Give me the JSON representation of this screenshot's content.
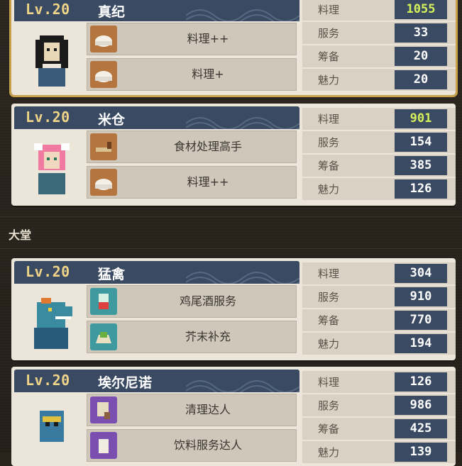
{
  "section": {
    "title": "大堂"
  },
  "cards": [
    {
      "level": "Lv.20",
      "name": "真纪",
      "skills": [
        {
          "label": "料理++",
          "icon": "rice-icon"
        },
        {
          "label": "料理+",
          "icon": "rice-icon"
        }
      ],
      "stats": [
        {
          "k": "料理",
          "v": "1055",
          "hi": true
        },
        {
          "k": "服务",
          "v": "33"
        },
        {
          "k": "筹备",
          "v": "20"
        },
        {
          "k": "魅力",
          "v": "20"
        }
      ]
    },
    {
      "level": "Lv.20",
      "name": "米仓",
      "skills": [
        {
          "label": "食材处理高手",
          "icon": "knife-icon"
        },
        {
          "label": "料理++",
          "icon": "rice-icon"
        }
      ],
      "stats": [
        {
          "k": "料理",
          "v": "901",
          "hi": true
        },
        {
          "k": "服务",
          "v": "154"
        },
        {
          "k": "筹备",
          "v": "385"
        },
        {
          "k": "魅力",
          "v": "126"
        }
      ]
    },
    {
      "level": "Lv.20",
      "name": "猛禽",
      "skills": [
        {
          "label": "鸡尾酒服务",
          "icon": "cocktail-icon"
        },
        {
          "label": "芥末补充",
          "icon": "wasabi-icon"
        }
      ],
      "stats": [
        {
          "k": "料理",
          "v": "304"
        },
        {
          "k": "服务",
          "v": "910"
        },
        {
          "k": "筹备",
          "v": "770"
        },
        {
          "k": "魅力",
          "v": "194"
        }
      ]
    },
    {
      "level": "Lv.20",
      "name": "埃尔尼诺",
      "skills": [
        {
          "label": "清理达人",
          "icon": "broom-icon"
        },
        {
          "label": "饮料服务达人",
          "icon": "drink-icon"
        }
      ],
      "stats": [
        {
          "k": "料理",
          "v": "126"
        },
        {
          "k": "服务",
          "v": "986"
        },
        {
          "k": "筹备",
          "v": "425"
        },
        {
          "k": "魅力",
          "v": "139"
        }
      ]
    }
  ]
}
